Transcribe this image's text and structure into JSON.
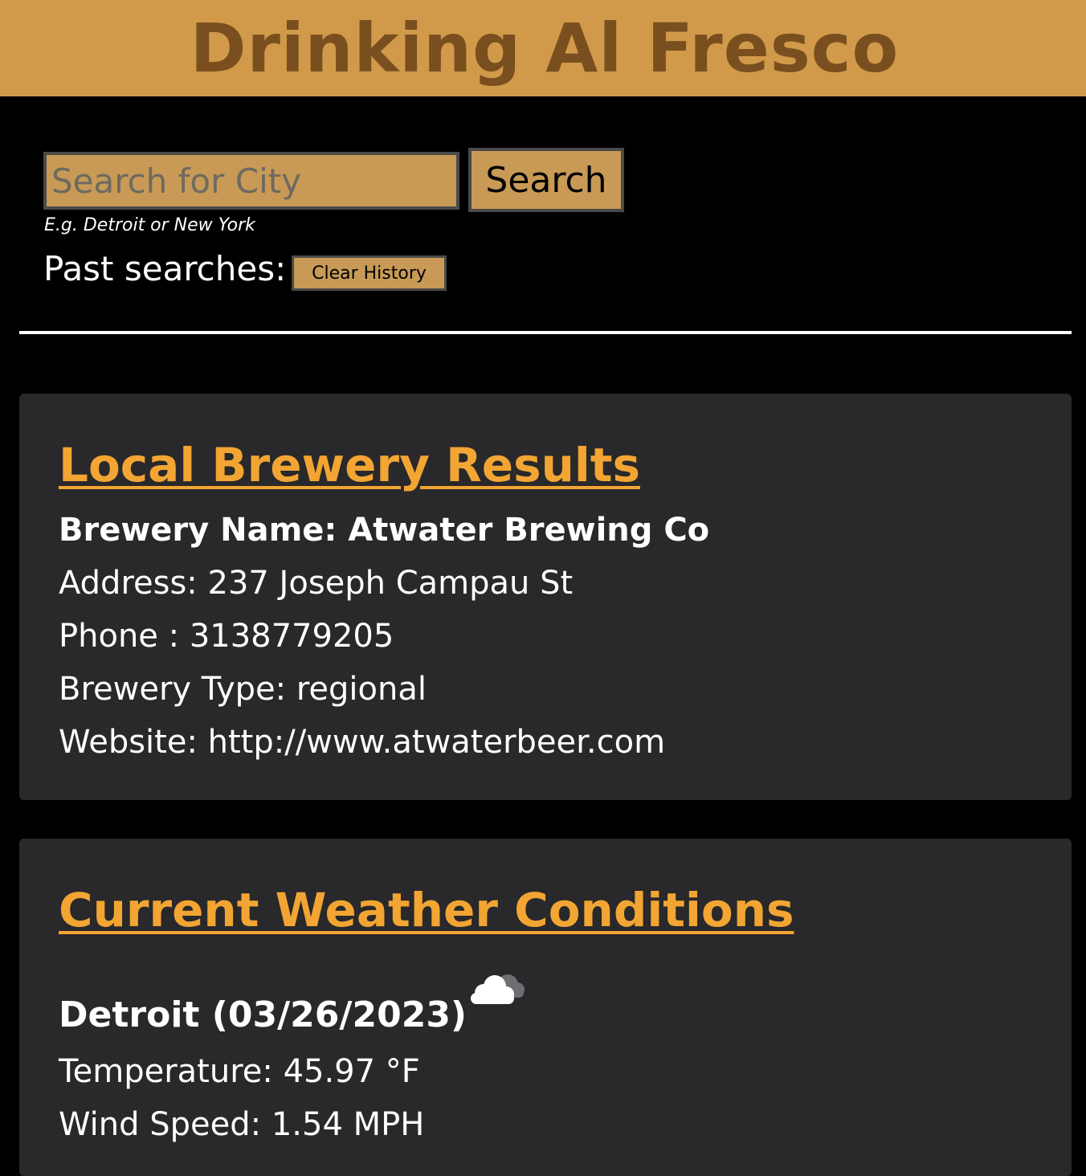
{
  "header": {
    "title": "Drinking Al Fresco"
  },
  "search": {
    "placeholder": "Search for City",
    "value": "",
    "button_label": "Search",
    "hint": "E.g. Detroit or New York"
  },
  "history": {
    "label": "Past searches:",
    "clear_label": "Clear History"
  },
  "brewery": {
    "title": "Local Brewery Results",
    "name_line": "Brewery Name: Atwater Brewing Co",
    "address_line": "Address: 237 Joseph Campau St",
    "phone_line": "Phone : 3138779205",
    "type_line": "Brewery Type: regional",
    "website_line": "Website: http://www.atwaterbeer.com"
  },
  "weather": {
    "title": "Current Weather Conditions",
    "city_date": "Detroit (03/26/2023)",
    "icon": "cloud-icon",
    "temperature_line": "Temperature: 45.97 °F",
    "wind_line": "Wind Speed: 1.54 MPH"
  },
  "colors": {
    "header_bg": "#d19a4a",
    "header_text": "#7a4f1f",
    "accent": "#f2a533",
    "card_bg": "#29282a",
    "button_bg": "#c89a56"
  }
}
